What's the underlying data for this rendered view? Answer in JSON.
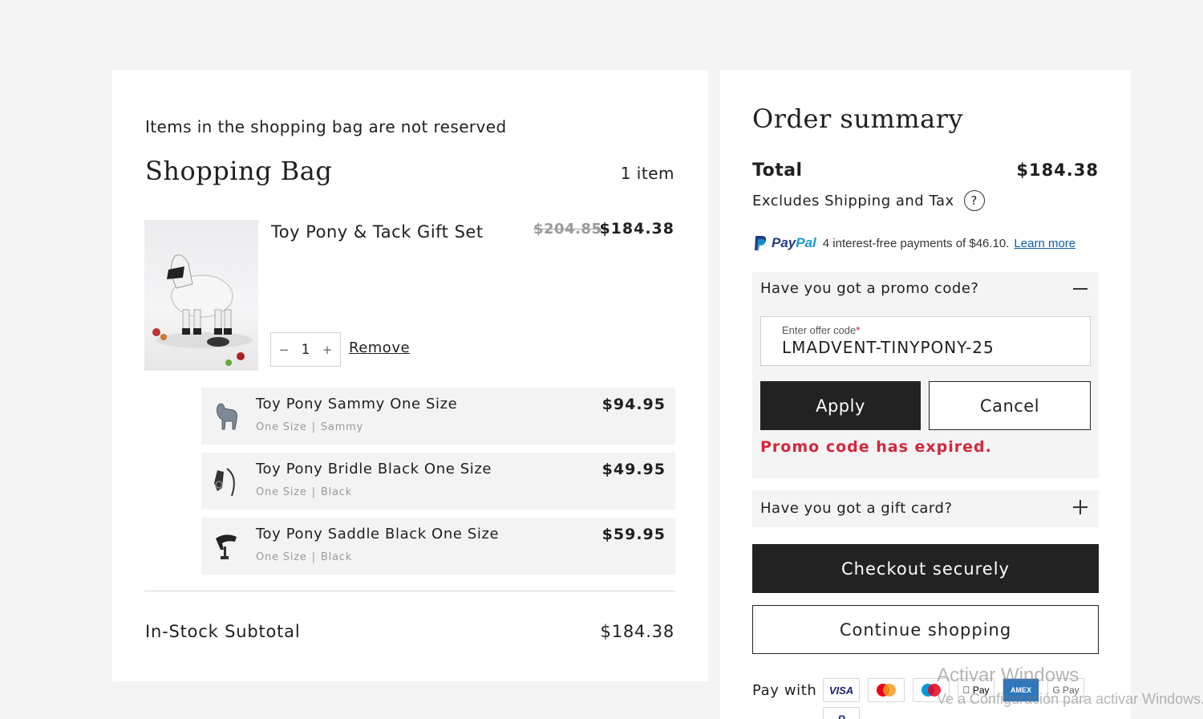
{
  "bag": {
    "notice": "Items in the shopping bag are not reserved",
    "title": "Shopping Bag",
    "count": "1 item",
    "product": {
      "name": "Toy Pony & Tack Gift Set",
      "price_old": "$204.85",
      "price_new": "$184.38",
      "quantity": "1",
      "qty_minus": "−",
      "qty_plus": "+",
      "remove_label": "Remove"
    },
    "set_items": [
      {
        "name": "Toy Pony Sammy One Size",
        "size": "One Size",
        "sep": "|",
        "variant": "Sammy",
        "price": "$94.95",
        "icon": "pony-icon"
      },
      {
        "name": "Toy Pony Bridle Black One Size",
        "size": "One Size",
        "sep": "|",
        "variant": "Black",
        "price": "$49.95",
        "icon": "bridle-icon"
      },
      {
        "name": "Toy Pony Saddle Black One Size",
        "size": "One Size",
        "sep": "|",
        "variant": "Black",
        "price": "$59.95",
        "icon": "saddle-icon"
      }
    ],
    "subtotal_label": "In-Stock Subtotal",
    "subtotal_value": "$184.38"
  },
  "summary": {
    "title": "Order summary",
    "total_label": "Total",
    "total_value": "$184.38",
    "excludes": "Excludes Shipping and Tax",
    "help_glyph": "?",
    "paypal": {
      "logo_pay": "Pay",
      "logo_pal": "Pal",
      "message": "4 interest-free payments of $46.10.",
      "learn_more": "Learn more"
    },
    "promo": {
      "heading": "Have you got a promo code?",
      "field_label": "Enter offer code",
      "required_mark": "*",
      "value": "LMADVENT-TINYPONY-25",
      "apply": "Apply",
      "cancel": "Cancel",
      "error": "Promo code has expired."
    },
    "gift_heading": "Have you got a gift card?",
    "checkout": "Checkout securely",
    "continue": "Continue shopping",
    "pay_with": "Pay with",
    "cards": [
      {
        "name": "visa-icon",
        "label": "VISA"
      },
      {
        "name": "mastercard-icon",
        "label": ""
      },
      {
        "name": "maestro-icon",
        "label": ""
      },
      {
        "name": "apple-pay-icon",
        "label": " Pay"
      },
      {
        "name": "amex-icon",
        "label": "AMEX"
      },
      {
        "name": "google-pay-icon",
        "label": "G Pay"
      },
      {
        "name": "paypal-card-icon",
        "label": "P"
      }
    ]
  },
  "watermark": {
    "line1": "Activar Windows",
    "line2": "Ve a Configuración para activar Windows."
  },
  "colors": {
    "error": "#d6263b",
    "button_dark": "#222222",
    "paypal_blue": "#253b80",
    "paypal_light": "#179bd7",
    "link": "#0b5db3"
  }
}
